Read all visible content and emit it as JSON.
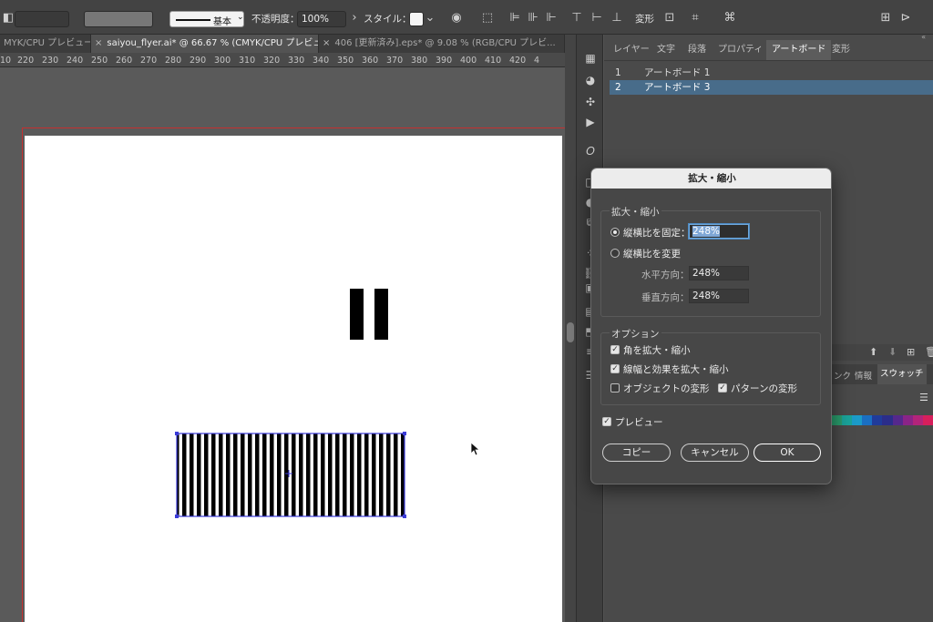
{
  "control_bar": {
    "stroke_style": "基本",
    "opacity_label": "不透明度：",
    "opacity_value": "100%",
    "style_label": "スタイル：",
    "transform_label": "変形"
  },
  "doc_tabs": [
    {
      "label": "MYK/CPU プレビュー..."
    },
    {
      "label": "saiyou_flyer.ai* @ 66.67 % (CMYK/CPU プレビュー)",
      "active": true
    },
    {
      "label": "406 [更新済み].eps* @ 9.08 % (RGB/CPU プレビ..."
    }
  ],
  "ruler_ticks": [
    "10",
    "220",
    "230",
    "240",
    "250",
    "260",
    "270",
    "280",
    "290",
    "300",
    "310",
    "320",
    "330",
    "340",
    "350",
    "360",
    "370",
    "380",
    "390",
    "400",
    "410",
    "420",
    "4"
  ],
  "panel": {
    "tabs": [
      "レイヤー",
      "文字",
      "段落",
      "プロパティ",
      "アートボード",
      "変形"
    ],
    "artboards": [
      {
        "num": "1",
        "name": "アートボード 1"
      },
      {
        "num": "2",
        "name": "アートボード 3"
      }
    ],
    "lower_tabs": [
      "ンク",
      "情報",
      "スウォッチ"
    ]
  },
  "dialog": {
    "title": "拡大・縮小",
    "scale_group_label": "拡大・縮小",
    "uniform_label": "縦横比を固定：",
    "uniform_value": "248%",
    "nonuniform_label": "縦横比を変更",
    "horizontal_label": "水平方向：",
    "horizontal_value": "248%",
    "vertical_label": "垂直方向：",
    "vertical_value": "248%",
    "options_label": "オプション",
    "scale_corners": "角を拡大・縮小",
    "scale_strokes": "線幅と効果を拡大・縮小",
    "transform_objects": "オブジェクトの変形",
    "transform_patterns": "パターンの変形",
    "preview": "プレビュー",
    "copy_button": "コピー",
    "cancel_button": "キャンセル",
    "ok_button": "OK"
  },
  "colors": {
    "selection": "#3b3bd8",
    "dialog_bg": "#474747",
    "selected_row": "#486c8a"
  }
}
